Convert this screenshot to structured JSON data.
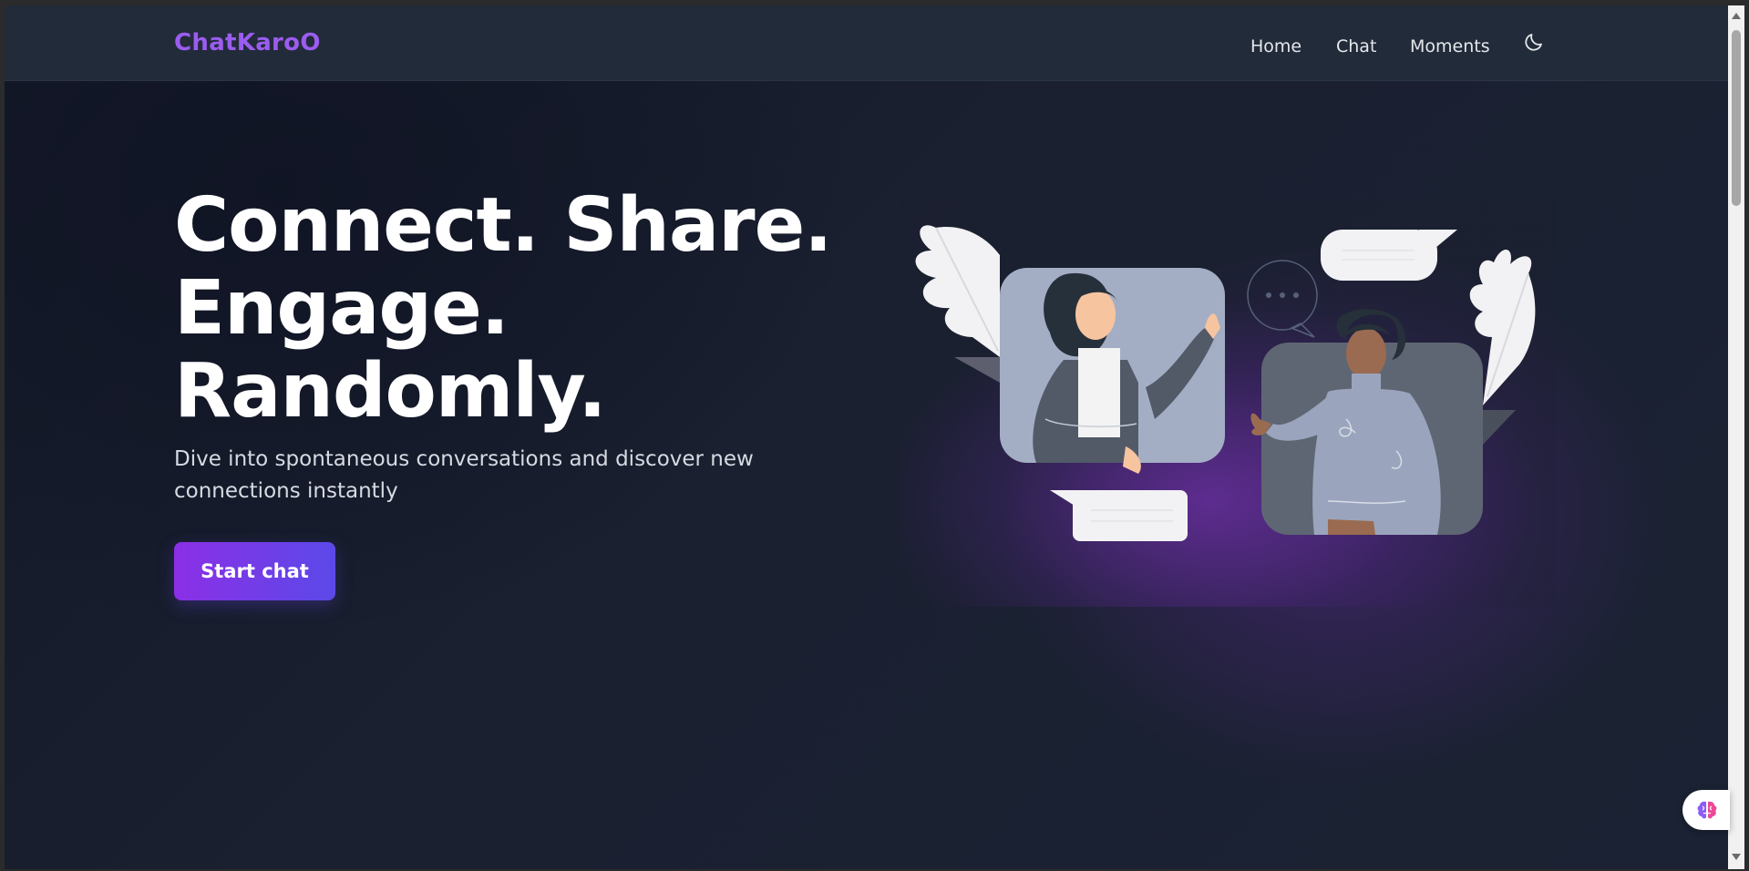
{
  "brand": {
    "name": "ChatKaroO"
  },
  "nav": {
    "links": [
      {
        "label": "Home"
      },
      {
        "label": "Chat"
      },
      {
        "label": "Moments"
      }
    ],
    "theme_toggle_icon": "moon-icon"
  },
  "hero": {
    "title_lines": [
      "Connect. Share.",
      "Engage.",
      "Randomly."
    ],
    "subtitle": "Dive into spontaneous conversations and discover new connections instantly",
    "cta_label": "Start chat"
  },
  "illustration": {
    "subject": "two-people-chatting-illustration"
  },
  "assistant_widget": {
    "icon": "brain-icon"
  },
  "colors": {
    "brand": "#9b5cf0",
    "cta_start": "#8b2fe6",
    "cta_end": "#5b49e8",
    "navbar_bg": "#222b3a",
    "page_bg": "#1a2030"
  }
}
